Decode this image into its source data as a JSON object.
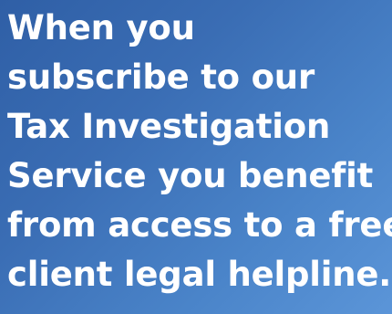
{
  "banner": {
    "lines": [
      "When you",
      "subscribe to our",
      "Tax Investigation",
      "Service you benefit",
      "from access to a free",
      "client legal helpline."
    ]
  },
  "colors": {
    "background_start": "#2f5fa6",
    "background_end": "#5b95d8",
    "text": "#ffffff"
  }
}
